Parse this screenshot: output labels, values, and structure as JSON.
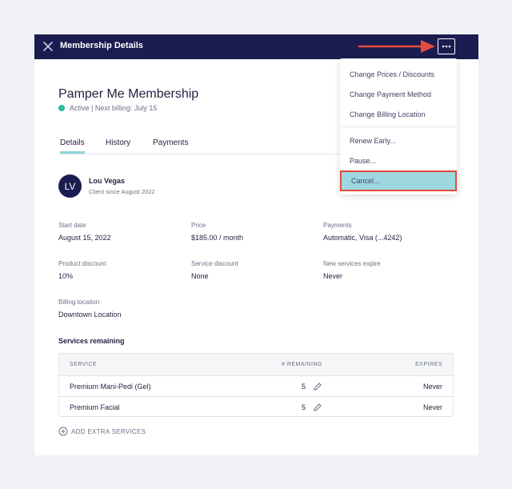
{
  "header": {
    "title": "Membership Details",
    "close_icon": "close-icon",
    "more_icon": "ellipsis-icon"
  },
  "membership": {
    "name": "Pamper Me Membership",
    "status": "Active | Next billing: July 15",
    "status_color": "#26c19b"
  },
  "tabs": [
    {
      "label": "Details",
      "active": true
    },
    {
      "label": "History",
      "active": false
    },
    {
      "label": "Payments",
      "active": false
    }
  ],
  "client": {
    "initials": "LV",
    "name": "Lou Vegas",
    "since": "Client since August 2022"
  },
  "fields": {
    "start_date": {
      "label": "Start date",
      "value": "August 15, 2022"
    },
    "price": {
      "label": "Price",
      "value": "$185.00 / month"
    },
    "payments": {
      "label": "Payments",
      "value": "Automatic, Visa (...4242)"
    },
    "product_discount": {
      "label": "Product discount",
      "value": "10%"
    },
    "service_discount": {
      "label": "Service discount",
      "value": "None"
    },
    "new_services_expire": {
      "label": "New services expire",
      "value": "Never"
    },
    "billing_location": {
      "label": "Billing location",
      "value": "Downtown Location"
    }
  },
  "services": {
    "title": "Services remaining",
    "columns": [
      "SERVICE",
      "# REMAINING",
      "EXPIRES"
    ],
    "rows": [
      {
        "service": "Premium Mani-Pedi (Gel)",
        "remaining": "5",
        "expires": "Never"
      },
      {
        "service": "Premium Facial",
        "remaining": "5",
        "expires": "Never"
      }
    ],
    "add_label": "ADD EXTRA SERVICES"
  },
  "menu": {
    "items": [
      "Change Prices / Discounts",
      "Change Payment Method",
      "Change Billing Location",
      "Renew Early...",
      "Pause...",
      "Cancel..."
    ]
  },
  "colors": {
    "header_bg": "#1b1c4f",
    "highlight": "#9dd8e0",
    "callout": "#e64b3c"
  }
}
